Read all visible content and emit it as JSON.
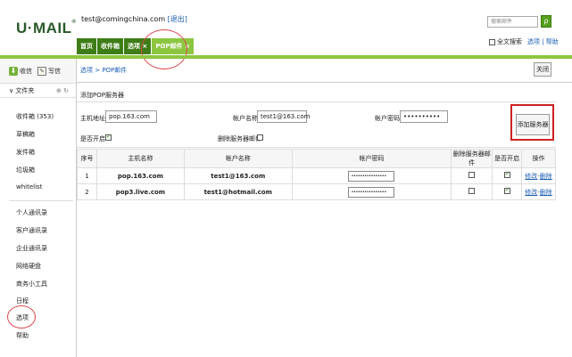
{
  "header": {
    "logo": "U·MAIL",
    "logo_mark": "®",
    "user_email": "test@comingchina.com",
    "logout": "[退出]",
    "search_placeholder": "搜索邮件",
    "search_button": "ρ",
    "fulltext_label": "全文搜索",
    "links": "选项 | 帮助"
  },
  "top_tabs": [
    "首页",
    "收件箱",
    "选项 ×",
    "POP邮件 ×"
  ],
  "sidebar": {
    "receive_label": "收信",
    "write_label": "写信",
    "folder_head": "∨ 文件夹",
    "folder_ops": "⊕ ↻",
    "folders": [
      "收件箱 (353)",
      "草稿箱",
      "发件箱",
      "垃圾箱",
      "whitelist"
    ],
    "tools": [
      "个人通讯录",
      "客户通讯录",
      "企业通讯录",
      "网络硬盘",
      "商务小工具",
      "日程",
      "选项",
      "帮助"
    ]
  },
  "main": {
    "breadcrumb": "选项 > POP邮件",
    "close": "关闭",
    "section_title": "添加POP服务器",
    "form": {
      "host_label": "主机地址:",
      "host_value": "pop.163.com",
      "account_label": "帐户名称:",
      "account_value": "test1@163.com",
      "password_label": "帐户密码:",
      "password_value": "••••••••••",
      "enabled_label": "是否开启:",
      "delete_label": "删除服务器邮件:",
      "add_button": "添加服务器"
    },
    "table": {
      "headers": [
        "序号",
        "主机名称",
        "帐户名称",
        "帐户密码",
        "删除服务器邮件",
        "是否开启",
        "操作"
      ],
      "rows": [
        {
          "num": "1",
          "host": "pop.163.com",
          "account": "test1@163.com",
          "password": "••••••••••••••••",
          "edit": "修改",
          "sep": "-",
          "delete": "删除"
        },
        {
          "num": "2",
          "host": "pop3.live.com",
          "account": "test1@hotmail.com",
          "password": "••••••••••••••••",
          "edit": "修改",
          "sep": "-",
          "delete": "删除"
        }
      ]
    }
  }
}
